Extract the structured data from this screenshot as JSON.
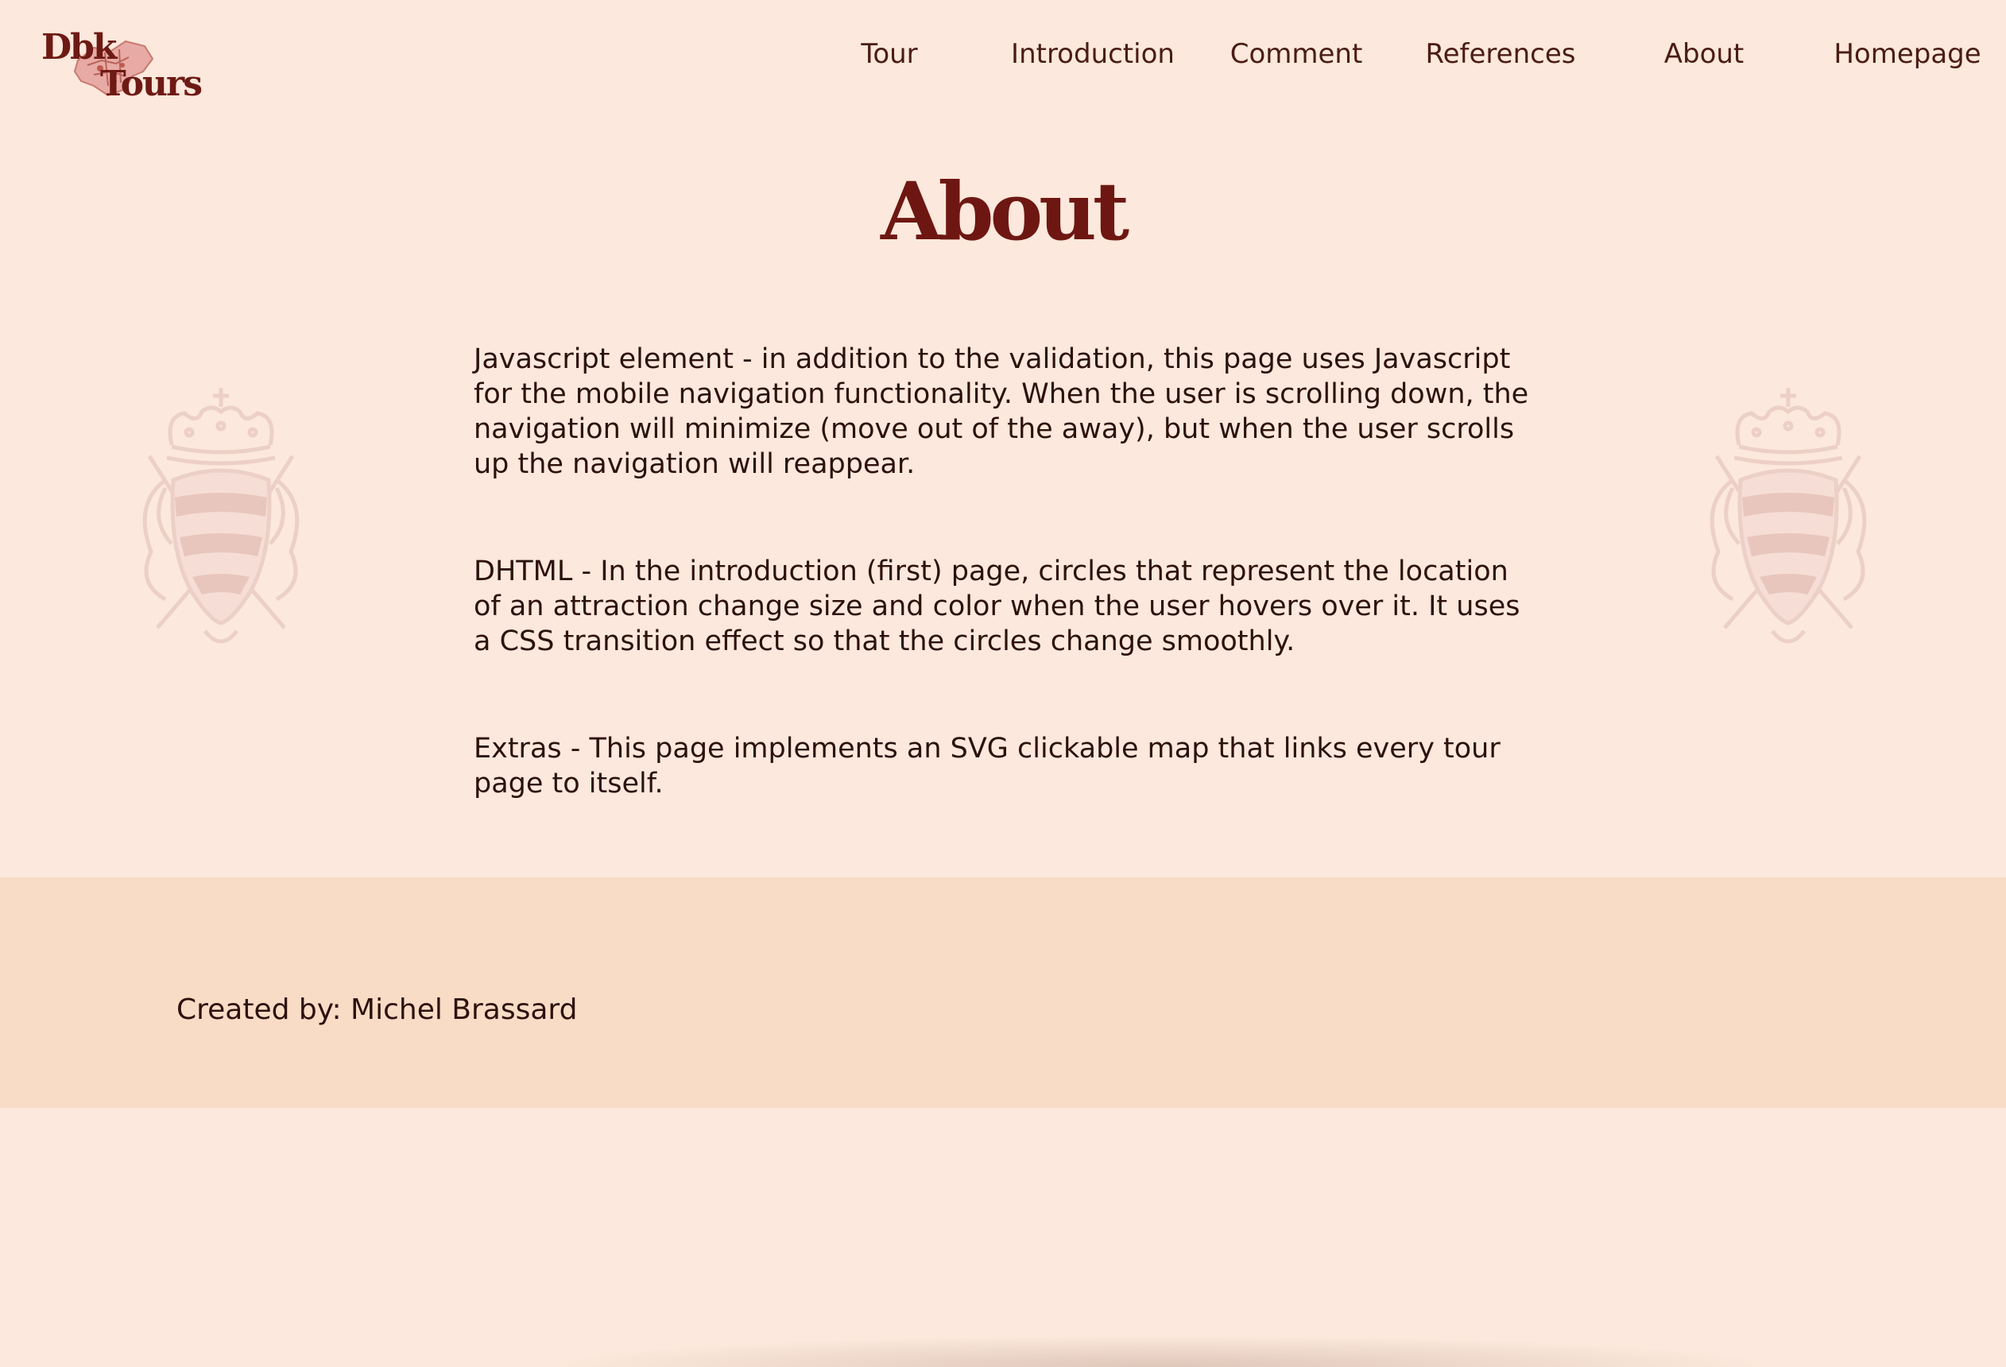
{
  "header": {
    "logo": {
      "line1": "Dbk",
      "line2": "Tours"
    },
    "nav": [
      {
        "label": "Tour"
      },
      {
        "label": "Introduction"
      },
      {
        "label": "Comment"
      },
      {
        "label": "References"
      },
      {
        "label": "About"
      },
      {
        "label": "Homepage"
      }
    ]
  },
  "main": {
    "title": "About",
    "paragraphs": [
      "Javascript element - in addition to the validation, this page uses Javascript for the mobile navigation functionality. When the user is scrolling down, the navigation will minimize (move out of the away), but when the user scrolls up the navigation will reappear.",
      "DHTML - In the introduction (first) page, circles that represent the location of an attraction change size and color when the user hovers over it. It uses a CSS transition effect so that the circles change smoothly.",
      "Extras - This page implements an SVG clickable map that links every tour page to itself."
    ]
  },
  "footer": {
    "credit": "Created by: Michel Brassard"
  },
  "colors": {
    "background": "#fce8dc",
    "footer_background": "#f9dcc5",
    "accent": "#6e1712",
    "text": "#2d110c",
    "crest": "#e8c6bd"
  },
  "icons": [
    "logo-map-icon",
    "coat-of-arms-icon"
  ]
}
